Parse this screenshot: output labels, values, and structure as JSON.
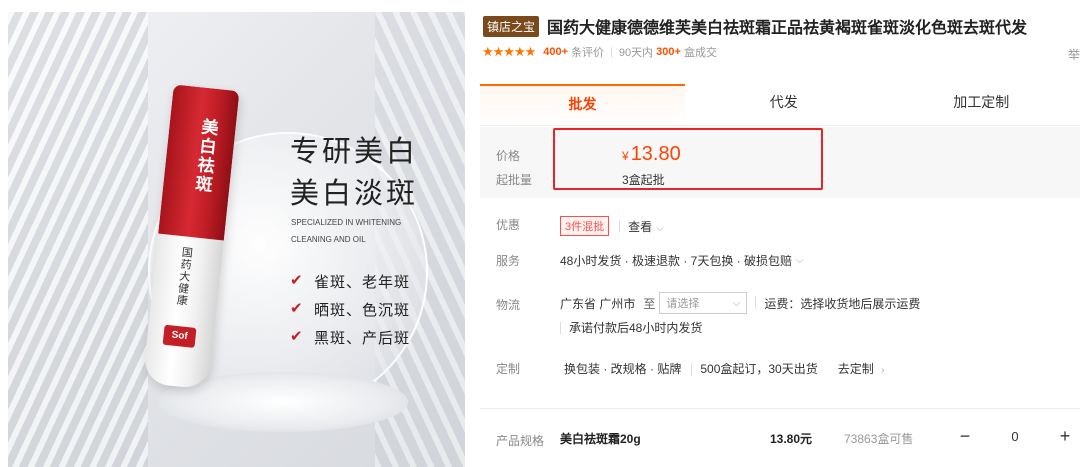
{
  "hero": {
    "title_line1": "专研美白",
    "title_line2": "美白淡斑",
    "en_line1": "SPECIALIZED IN WHITENING",
    "en_line2": "CLEANING AND OIL",
    "points": [
      "雀斑、老年斑",
      "晒斑、色沉斑",
      "黑斑、产后斑"
    ],
    "tube_text": "美白祛斑",
    "tube_brand": "国药大健康",
    "tube_logo": "Sof"
  },
  "product": {
    "badge": "镇店之宝",
    "title": "国药大健康德德维芙美白祛斑霜正品祛黄褐斑雀斑淡化色斑去斑代发",
    "stars": "★★★★★",
    "reviews_count": "400+",
    "reviews_label": "条评价",
    "sold_prefix": "90天内",
    "sold_count": "300+",
    "sold_suffix": "盒成交",
    "share_label": "举"
  },
  "tabs": [
    "批发",
    "代发",
    "加工定制"
  ],
  "price": {
    "label_price": "价格",
    "label_min": "起批量",
    "currency": "¥",
    "value": "13.80",
    "min_order": "3盒起批"
  },
  "discount": {
    "label": "优惠",
    "tag": "3件混批",
    "view": "查看"
  },
  "service": {
    "label": "服务",
    "text": "48小时发货 · 极速退款 · 7天包换 · 破损包赔"
  },
  "logistics": {
    "label": "物流",
    "origin": "广东省 广州市",
    "to": "至",
    "select_placeholder": "请选择",
    "fee": "运费：选择收货地后展示运费",
    "promise": "承诺付款后48小时内发货"
  },
  "custom": {
    "label": "定制",
    "options": "换包装 · 改规格 · 贴牌",
    "moq": "500盒起订，30天出货",
    "link": "去定制"
  },
  "spec": {
    "label": "产品规格",
    "name": "美白祛斑霜20g",
    "price": "13.80元",
    "stock": "73863盒可售",
    "minus": "−",
    "qty": "0",
    "plus": "+"
  },
  "colors": {
    "accent": "#ff4400",
    "tab_active": "#ff6a00",
    "badge": "#7a4a1c",
    "highlight_border": "#e8232a"
  }
}
